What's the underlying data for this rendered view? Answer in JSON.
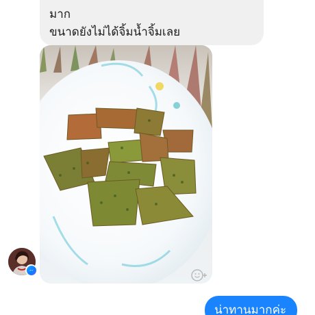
{
  "incoming_message": {
    "lines": [
      "มาก",
      "ขนาดยังไม่ได้จิ้มน้ำจิ้มเลย"
    ]
  },
  "photo": {
    "icon": "food-photo"
  },
  "reaction": {
    "icon": "add-reaction-icon"
  },
  "sender": {
    "icon": "avatar",
    "badge_icon": "messenger-icon"
  },
  "outgoing_message": {
    "text": "น่าทานมากค่ะ"
  },
  "colors": {
    "incoming_bubble": "#f0f0f0",
    "outgoing_bubble": "#1a84ff",
    "messenger_blue": "#0a7cff"
  }
}
